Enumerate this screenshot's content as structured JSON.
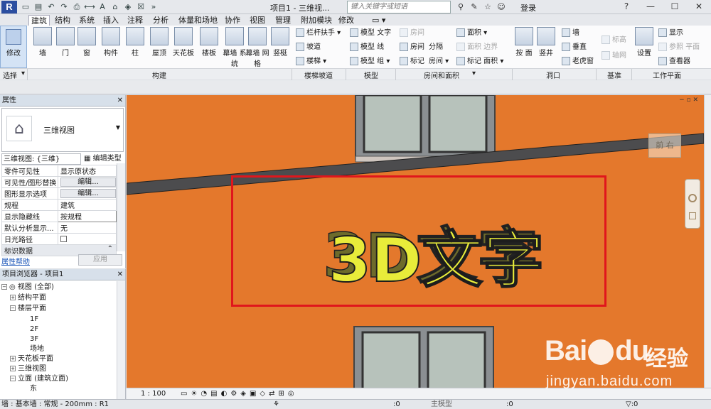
{
  "titlebar": {
    "app_logo": "R",
    "doc_title": "项目1 - 三维视...",
    "search_placeholder": "键入关键字或短语",
    "login": "登录"
  },
  "tabs": [
    "建筑",
    "结构",
    "系统",
    "插入",
    "注释",
    "分析",
    "体量和场地",
    "协作",
    "视图",
    "管理",
    "附加模块",
    "修改"
  ],
  "active_tab": "建筑",
  "ribbon": {
    "modify": "修改",
    "build_buttons": [
      "墙",
      "门",
      "窗",
      "构件",
      "柱",
      "屋顶",
      "天花板",
      "楼板",
      "幕墙\n系统",
      "幕墙\n网格",
      "竖梃"
    ],
    "stair": [
      "栏杆扶手",
      "坡道",
      "楼梯"
    ],
    "model": [
      "模型 文字",
      "模型 线",
      "模型 组"
    ],
    "room_disabled": [
      "房间",
      "房间",
      "标记"
    ],
    "room_items": [
      "分隔",
      "房间"
    ],
    "area": [
      "面积",
      "面积 边界",
      "标记 面积"
    ],
    "opening": [
      "按\n面",
      "竖井",
      "墙",
      "垂直",
      "老虎窗"
    ],
    "datum": [
      "标高",
      "轴网"
    ],
    "workplane": [
      "设置",
      "显示",
      "参照 平面",
      "查看器"
    ],
    "panels": [
      "选择",
      "构建",
      "楼梯坡道",
      "模型",
      "房间和面积",
      "洞口",
      "基准",
      "工作平面"
    ]
  },
  "properties": {
    "title": "属性",
    "type_name": "三维视图",
    "view_selector": "三维视图: {三维}",
    "edit_type": "编辑类型",
    "rows": [
      {
        "name": "零件可见性",
        "value": "显示原状态"
      },
      {
        "name": "可见性/图形替换",
        "value": "编辑..."
      },
      {
        "name": "图形显示选项",
        "value": "编辑..."
      },
      {
        "name": "规程",
        "value": "建筑"
      },
      {
        "name": "显示隐藏线",
        "value": "按规程"
      },
      {
        "name": "默认分析显示...",
        "value": "无"
      },
      {
        "name": "日光路径",
        "value": ""
      }
    ],
    "section": "标识数据",
    "help": "属性帮助",
    "apply": "应用"
  },
  "browser": {
    "title": "项目浏览器 - 项目1",
    "items": [
      "视图 (全部)",
      "结构平面",
      "楼层平面",
      "1F",
      "2F",
      "3F",
      "场地",
      "天花板平面",
      "三维视图",
      "立面 (建筑立面)",
      "东"
    ]
  },
  "viewport": {
    "cube_label": "前 右",
    "model_text": "3D文字",
    "colors": {
      "wall": "#e4782c",
      "text_face": "#e8ec3a",
      "text_side": "#6d6b2b",
      "selection": "#e0161c"
    }
  },
  "viewcontrol": {
    "scale": "1 : 100"
  },
  "statusbar": {
    "text": "墙 : 基本墙 : 常规 - 200mm : R1",
    "zero1": ":0",
    "model": "主模型",
    "zero2": ":0"
  },
  "watermark": {
    "brand": "Bai",
    "brand_tail": "du",
    "jy": "经验",
    "url": "jingyan.baidu.com"
  }
}
